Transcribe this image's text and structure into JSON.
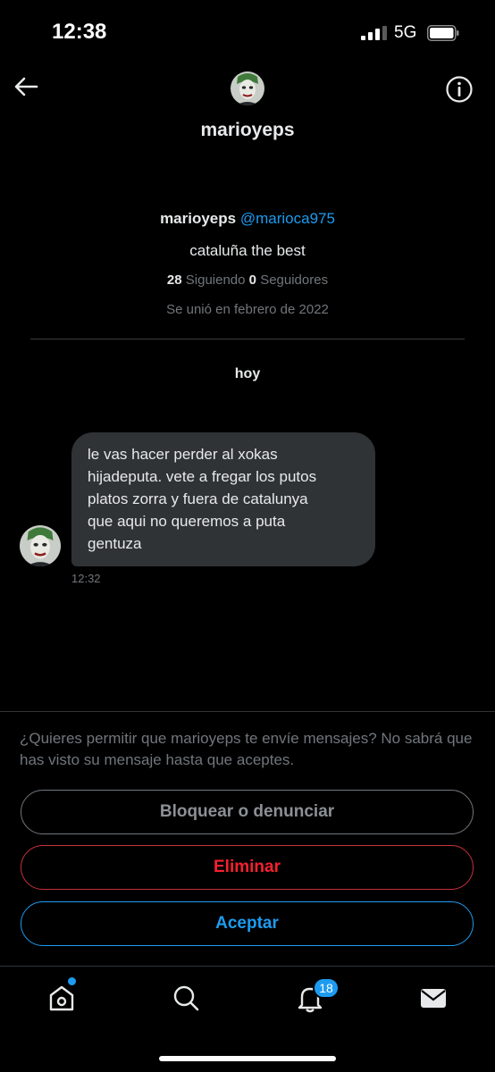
{
  "status": {
    "time": "12:38",
    "network": "5G"
  },
  "header": {
    "name": "marioyeps",
    "back_icon": "arrow-left-icon",
    "info_icon": "info-icon"
  },
  "profile": {
    "name": "marioyeps",
    "handle": "@marioca975",
    "bio": "cataluña the best",
    "following_count": "28",
    "following_label": "Siguiendo",
    "followers_count": "0",
    "followers_label": "Seguidores",
    "joined": "Se unió en febrero de 2022"
  },
  "conversation": {
    "day_label": "hoy",
    "message": {
      "text": "le vas hacer perder al xokas\nhijadeputa. vete a fregar los putos\nplatos zorra y fuera de catalunya\nque aqui no queremos a puta\ngentuza",
      "time": "12:32"
    }
  },
  "request": {
    "prompt": "¿Quieres permitir que marioyeps te envíe mensajes? No sabrá que has visto su mensaje hasta que aceptes.",
    "block_label": "Bloquear o denunciar",
    "delete_label": "Eliminar",
    "accept_label": "Aceptar"
  },
  "tabbar": {
    "notifications_badge": "18",
    "colors": {
      "accent": "#1d9bf0",
      "danger": "#f4212e",
      "muted": "#71767b"
    }
  }
}
